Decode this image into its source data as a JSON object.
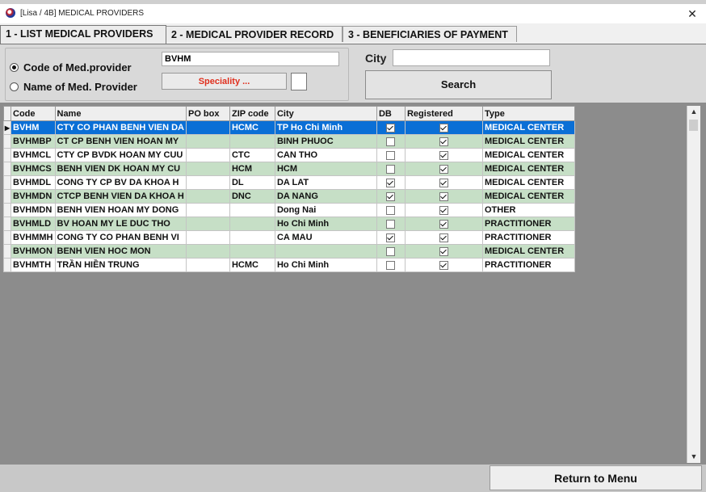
{
  "window": {
    "title": "[Lisa / 4B] MEDICAL PROVIDERS",
    "close_symbol": "✕"
  },
  "tabs": [
    {
      "label": "1 - LIST MEDICAL PROVIDERS"
    },
    {
      "label": "2 - MEDICAL PROVIDER RECORD"
    },
    {
      "label": "3 - BENEFICIARIES OF PAYMENT"
    }
  ],
  "filters": {
    "code_label": "Code of Med.provider",
    "name_label": "Name of Med. Provider",
    "code_value": "BVHM",
    "speciality_label": "Speciality ...",
    "city_label": "City",
    "city_value": "",
    "search_label": "Search"
  },
  "table": {
    "columns": [
      "Code",
      "Name",
      "PO box",
      "ZIP code",
      "City",
      "DB",
      "Registered",
      "Type"
    ],
    "rows": [
      {
        "code": "BVHM",
        "name": "CTY CO PHAN BENH VIEN DA",
        "po": "",
        "zip": "HCMC",
        "city": "TP Ho Chi Minh",
        "db": true,
        "registered": true,
        "type": "MEDICAL CENTER"
      },
      {
        "code": "BVHMBP",
        "name": "CT CP BENH VIEN HOAN MY",
        "po": "",
        "zip": "",
        "city": "BINH PHUOC",
        "db": false,
        "registered": true,
        "type": "MEDICAL CENTER"
      },
      {
        "code": "BVHMCL",
        "name": "CTY CP BVDK HOAN MY CUU",
        "po": "",
        "zip": "CTC",
        "city": "CAN THO",
        "db": false,
        "registered": true,
        "type": "MEDICAL CENTER"
      },
      {
        "code": "BVHMCS",
        "name": "BENH VIEN DK HOAN MY CU",
        "po": "",
        "zip": "HCM",
        "city": "HCM",
        "db": false,
        "registered": true,
        "type": "MEDICAL CENTER"
      },
      {
        "code": "BVHMDL",
        "name": "CONG TY CP BV DA KHOA H",
        "po": "",
        "zip": "DL",
        "city": "DA LAT",
        "db": true,
        "registered": true,
        "type": "MEDICAL CENTER"
      },
      {
        "code": "BVHMDN",
        "name": "CTCP BENH VIEN DA KHOA H",
        "po": "",
        "zip": "DNC",
        "city": "DA NANG",
        "db": true,
        "registered": true,
        "type": "MEDICAL CENTER"
      },
      {
        "code": "BVHMDN",
        "name": "BENH VIEN HOAN MY DONG",
        "po": "",
        "zip": "",
        "city": "Dong Nai",
        "db": false,
        "registered": true,
        "type": "OTHER"
      },
      {
        "code": "BVHMLD",
        "name": "BV HOAN MY LE DUC THO",
        "po": "",
        "zip": "",
        "city": "Ho Chi Minh",
        "db": false,
        "registered": true,
        "type": "PRACTITIONER"
      },
      {
        "code": "BVHMMH",
        "name": "CONG TY CO PHAN BENH VI",
        "po": "",
        "zip": "",
        "city": "CA MAU",
        "db": true,
        "registered": true,
        "type": "PRACTITIONER"
      },
      {
        "code": "BVHMON",
        "name": "BENH VIEN HOC MON",
        "po": "",
        "zip": "",
        "city": "",
        "db": false,
        "registered": true,
        "type": "MEDICAL CENTER"
      },
      {
        "code": "BVHMTH",
        "name": "TRẦN HIỀN TRUNG",
        "po": "",
        "zip": "HCMC",
        "city": "Ho Chi Minh",
        "db": false,
        "registered": true,
        "type": "PRACTITIONER"
      }
    ]
  },
  "scrollbar": {
    "up_symbol": "▲",
    "down_symbol": "▼"
  },
  "footer": {
    "return_label": "Return to Menu"
  },
  "colors": {
    "selected_row": "#0a6fd6",
    "alt_row": "#c6dfc6",
    "speciality_text": "#e0301e"
  }
}
